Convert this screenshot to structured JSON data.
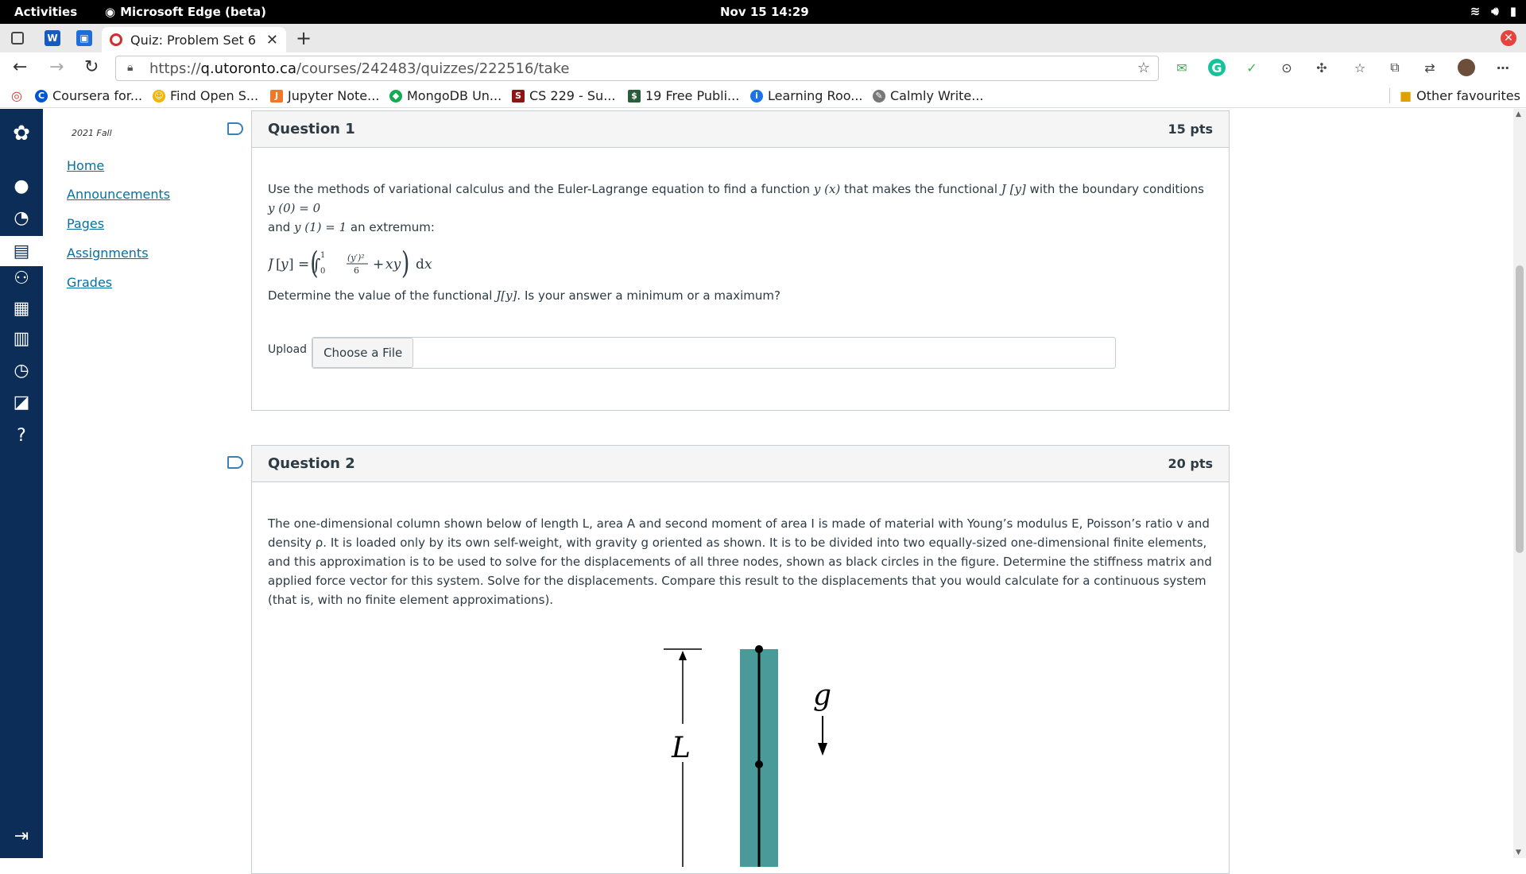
{
  "system": {
    "activities": "Activities",
    "app_name": "Microsoft Edge (beta)",
    "clock": "Nov 15  14:29"
  },
  "browser": {
    "active_tab_title": "Quiz: Problem Set 6",
    "url_prefix": "https://",
    "url_host": "q.utoronto.ca",
    "url_path": "/courses/242483/quizzes/222516/take"
  },
  "bookmarks": [
    {
      "label": "Coursera for...",
      "color": "#0056d2",
      "icon": "C"
    },
    {
      "label": "Find Open S...",
      "color": "#f4b400",
      "icon": "☺"
    },
    {
      "label": "Jupyter Note...",
      "color": "#f37726",
      "icon": "J"
    },
    {
      "label": "MongoDB Un...",
      "color": "#13aa52",
      "icon": "◆"
    },
    {
      "label": "CS 229 - Su...",
      "color": "#8c1515",
      "icon": "S"
    },
    {
      "label": "19 Free Publi...",
      "color": "#2b5d3b",
      "icon": "$"
    },
    {
      "label": "Learning Roo...",
      "color": "#1a73e8",
      "icon": "i"
    },
    {
      "label": "Calmly Write...",
      "color": "#555555",
      "icon": "✎"
    }
  ],
  "other_favourites": "Other favourites",
  "course": {
    "term": "2021 Fall",
    "nav": [
      "Home",
      "Announcements",
      "Pages",
      "Assignments",
      "Grades"
    ]
  },
  "questions": [
    {
      "title": "Question 1",
      "points": "15 pts",
      "upload_label": "Upload",
      "upload_button": "Choose a File"
    },
    {
      "title": "Question 2",
      "points": "20 pts",
      "text": "The one-dimensional column shown below of length L, area A and second moment of area I is made of material with Young’s modulus E, Poisson’s ratio v and density ρ. It is loaded only by its own self-weight, with gravity g oriented as shown. It is to be divided into two equally-sized one-dimensional finite elements, and this approximation is to be used to solve for the displacements of all three nodes, shown as black circles in the figure. Determine the stiffness matrix and applied force vector for this system. Solve for the displacements. Compare this result to the displacements that you would calculate for a continuous system (that is, with no finite element approximations).",
      "figure_length_label": "L",
      "figure_gravity_label": "g"
    }
  ],
  "q1_text": {
    "p1a": "Use the methods of variational calculus and the Euler-Lagrange equation to find a function ",
    "yx": "y (x)",
    "p1b": " that makes the functional ",
    "Jy": "J [y]",
    "p1c": " with the boundary conditions ",
    "bc1": "y (0)  =  0",
    "p1d": "and ",
    "bc2": "y (1)  =  1",
    "p1e": " an extremum:",
    "p2a": "Determine the value of the functional ",
    "Jy2": "J[y]",
    "p2b": ". Is your answer a minimum or a maximum?"
  },
  "colors": {
    "canvas_nav": "#0c2d57",
    "link": "#0770a3",
    "column": "#4a9a99"
  }
}
